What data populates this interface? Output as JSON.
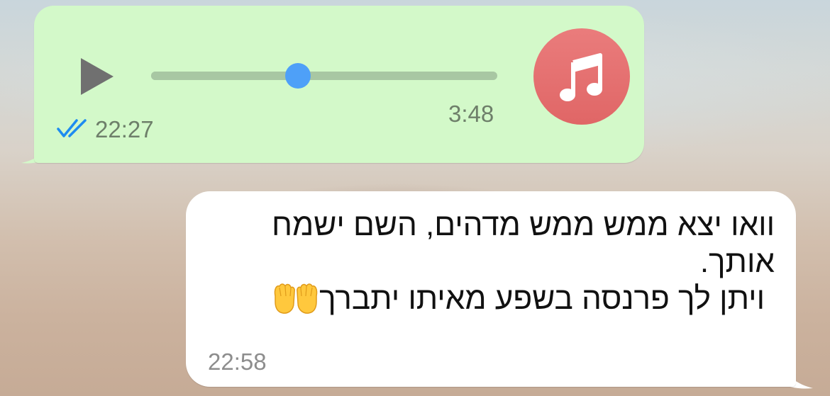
{
  "voice_message": {
    "duration": "3:48",
    "time": "22:27",
    "status": "read",
    "status_icon": "double-check-icon",
    "status_color": "#1d8cf0",
    "progress": 0.425,
    "avatar_icon": "music-note-icon",
    "avatar_color": "#e46d6d",
    "bubble_color": "#d3f9c9",
    "play_icon": "play-icon"
  },
  "text_message": {
    "lines": [
      "וואו יצא ממש ממש מדהים, השם ישמח",
      "אותך.",
      "ויתן לך פרנסה בשפע מאיתו יתברך"
    ],
    "emoji": "raising-hands-emoji",
    "time": "22:58",
    "bubble_color": "#ffffff"
  }
}
